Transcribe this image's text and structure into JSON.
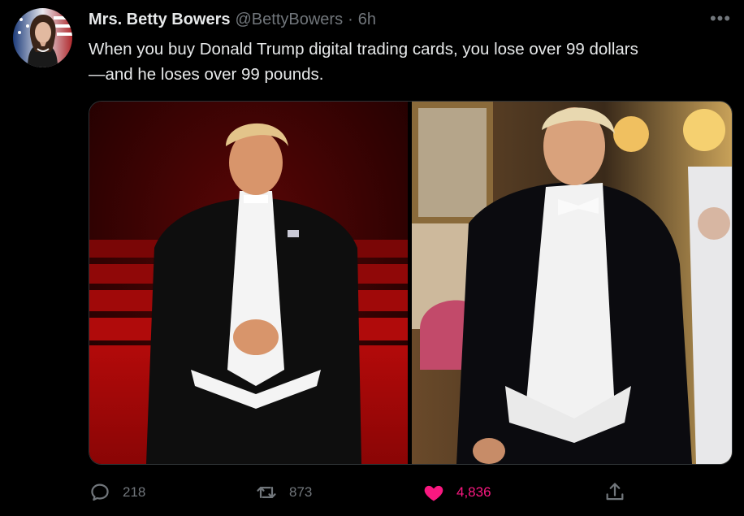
{
  "tweet": {
    "author_name": "Mrs. Betty Bowers",
    "handle": "@BettyBowers",
    "separator": "·",
    "time": "6h",
    "text_line1": "When you buy Donald Trump digital trading cards, you lose over 99 dollars",
    "text_line2": "—and he loses over 99 pounds.",
    "more_label": "•••"
  },
  "media": {
    "left_image": "digital-trading-card-render",
    "right_image": "event-photo"
  },
  "actions": {
    "reply_count": "218",
    "retweet_count": "873",
    "like_count": "4,836",
    "like_color": "#f91880"
  },
  "colors": {
    "background": "#000000",
    "text": "#e7e9ea",
    "secondary": "#71767b",
    "border": "#2f3336"
  }
}
